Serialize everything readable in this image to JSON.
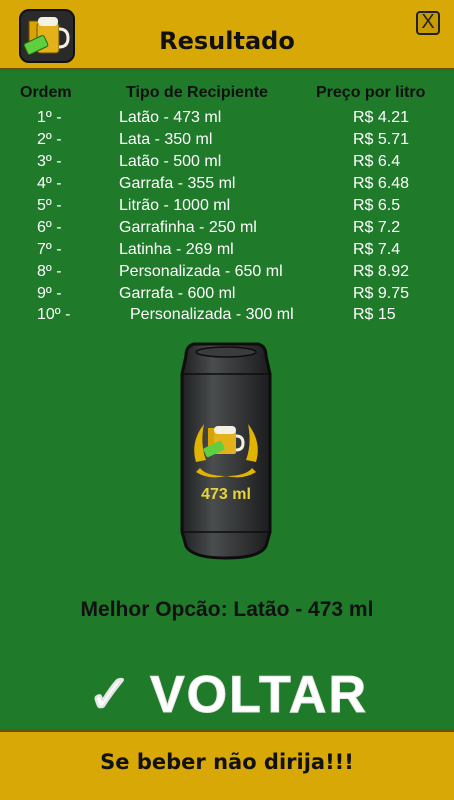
{
  "header": {
    "title": "Resultado",
    "close_label": "X"
  },
  "columns": {
    "order": "Ordem",
    "type": "Tipo de Recipiente",
    "price": "Preço por litro"
  },
  "rows": [
    {
      "order": "1º -",
      "type": "Latão - 473 ml",
      "price": "R$ 4.21"
    },
    {
      "order": "2º -",
      "type": "Lata - 350 ml",
      "price": "R$ 5.71"
    },
    {
      "order": "3º -",
      "type": "Latão - 500 ml",
      "price": "R$ 6.4"
    },
    {
      "order": "4º -",
      "type": "Garrafa - 355 ml",
      "price": "R$ 6.48"
    },
    {
      "order": "5º -",
      "type": "Litrão - 1000 ml",
      "price": "R$ 6.5"
    },
    {
      "order": "6º -",
      "type": "Garrafinha - 250 ml",
      "price": "R$ 7.2"
    },
    {
      "order": "7º -",
      "type": "Latinha - 269 ml",
      "price": "R$ 7.4"
    },
    {
      "order": "8º -",
      "type": "Personalizada - 650 ml",
      "price": "R$ 8.92"
    },
    {
      "order": "9º -",
      "type": "Garrafa - 600 ml",
      "price": "R$ 9.75"
    },
    {
      "order": "10º -",
      "type": "Personalizada - 300 ml",
      "price": "R$ 15"
    }
  ],
  "result": {
    "can_label": "473 ml",
    "best_option": "Melhor Opcão: Latão - 473 ml"
  },
  "voltar_label": "✓ VOLTAR",
  "footer": {
    "text": "Se beber não dirija!!!"
  },
  "colors": {
    "background": "#1f7a2a",
    "bar": "#d8a806",
    "can": "#2f3132",
    "laurel": "#e0b400"
  }
}
